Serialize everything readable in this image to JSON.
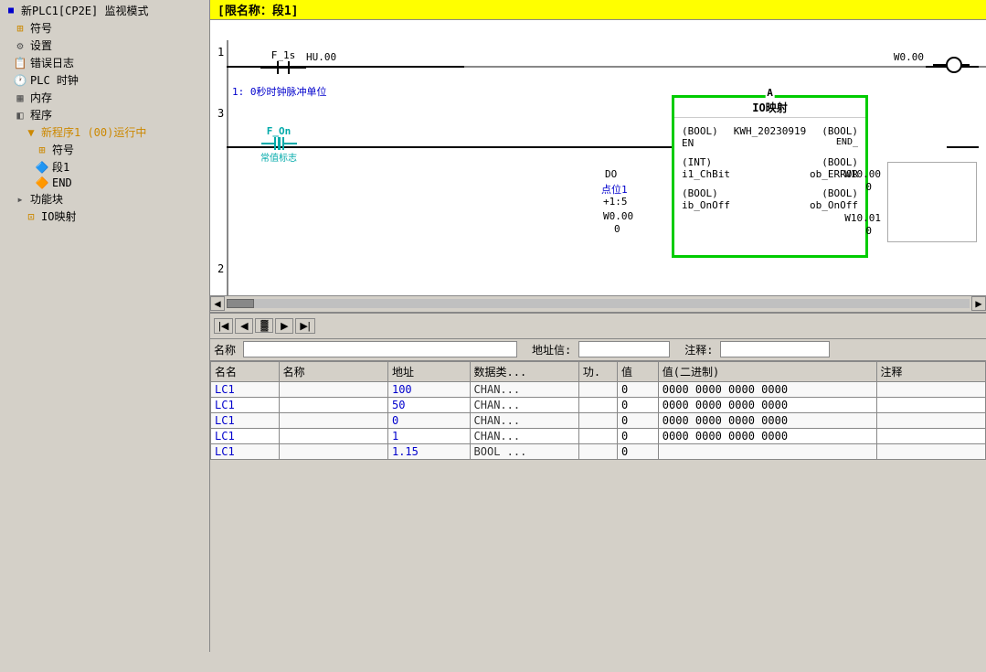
{
  "title_bar": {
    "text": "[限名称：段1]"
  },
  "sidebar": {
    "items": [
      {
        "id": "plc-root",
        "label": "新PLC1[CP2E] 监视模式",
        "indent": 0,
        "icon": "plc"
      },
      {
        "id": "symbol",
        "label": "符号",
        "indent": 1,
        "icon": "symbol"
      },
      {
        "id": "settings",
        "label": "设置",
        "indent": 1,
        "icon": "gear"
      },
      {
        "id": "error-log",
        "label": "错误日志",
        "indent": 1,
        "icon": "log"
      },
      {
        "id": "plc-timer",
        "label": "PLC 时钟",
        "indent": 1,
        "icon": "clock"
      },
      {
        "id": "memory",
        "label": "内存",
        "indent": 1,
        "icon": "memory"
      },
      {
        "id": "program",
        "label": "程序",
        "indent": 1,
        "icon": "program"
      },
      {
        "id": "new-prog",
        "label": "新程序1 (00)运行中",
        "indent": 2,
        "icon": "folder"
      },
      {
        "id": "symbol2",
        "label": "符号",
        "indent": 3,
        "icon": "symbol"
      },
      {
        "id": "seg1",
        "label": "段1",
        "indent": 3,
        "icon": "seg"
      },
      {
        "id": "end",
        "label": "END",
        "indent": 3,
        "icon": "end"
      },
      {
        "id": "funcblock",
        "label": "功能块",
        "indent": 1,
        "icon": "func"
      },
      {
        "id": "io-map",
        "label": "IO映射",
        "indent": 2,
        "icon": "io"
      }
    ]
  },
  "ladder": {
    "title": "[限名称：段1]",
    "rung1_num": "1",
    "rung1_comment": "1: 0秒时钟脉冲单位",
    "contact_f1s": "F_1s",
    "contact_hu00": "HU.00",
    "output_w000": "W0.00",
    "rung3_num": "3",
    "contact_fon_label": "F_On",
    "contact_fon_sublabel": "常值标志",
    "do_label": "DO",
    "pos1_label": "点位1",
    "plus115": "+1:5",
    "w000_rung": "W0.00",
    "w1000": "W10.00",
    "w1001": "W10.01",
    "num3": "3",
    "num_a": "A",
    "io_block_title": "IO映射",
    "io_en": "EN",
    "io_kwh": "KWH_20230919",
    "io_end": "END_",
    "io_int": "(INT)",
    "io_i1_chbit": "i1_ChBit",
    "io_ob_error": "ob_ERROR",
    "io_bool_ib": "(BOOL)",
    "io_ib_onoff": "ib_OnOff",
    "io_ob_onoff": "ob_OnOff",
    "bool_en": "(BOOL)",
    "bool_end": "(BOOL)",
    "bool_error": "(BOOL)",
    "bool_onoff_in": "(BOOL)",
    "bool_onoff_out": "(BOOL)"
  },
  "watch": {
    "search_label": "名称",
    "addr_label": "地址信:",
    "note_label": "注释:",
    "columns": [
      "名名",
      "名称",
      "地址",
      "数据类...",
      "功.",
      "值",
      "值(二进制)",
      "注释"
    ],
    "rows": [
      {
        "plc": "LC1",
        "name": "",
        "addr": "100",
        "dtype": "CHAN...",
        "func": "",
        "val": "0",
        "binval": "0000 0000 0000 0000",
        "note": ""
      },
      {
        "plc": "LC1",
        "name": "",
        "addr": "50",
        "dtype": "CHAN...",
        "func": "",
        "val": "0",
        "binval": "0000 0000 0000 0000",
        "note": ""
      },
      {
        "plc": "LC1",
        "name": "",
        "addr": "0",
        "dtype": "CHAN...",
        "func": "",
        "val": "0",
        "binval": "0000 0000 0000 0000",
        "note": ""
      },
      {
        "plc": "LC1",
        "name": "",
        "addr": "1",
        "dtype": "CHAN...",
        "func": "",
        "val": "0",
        "binval": "0000 0000 0000 0000",
        "note": ""
      },
      {
        "plc": "LC1",
        "name": "",
        "addr": "1.15",
        "dtype": "BOOL ...",
        "func": "",
        "val": "0",
        "binval": "",
        "note": ""
      }
    ]
  },
  "colors": {
    "green_border": "#00cc00",
    "yellow_bg": "#ffff00",
    "cyan": "#00aaaa",
    "blue": "#0000cc",
    "selected_row": "#316ac5"
  }
}
